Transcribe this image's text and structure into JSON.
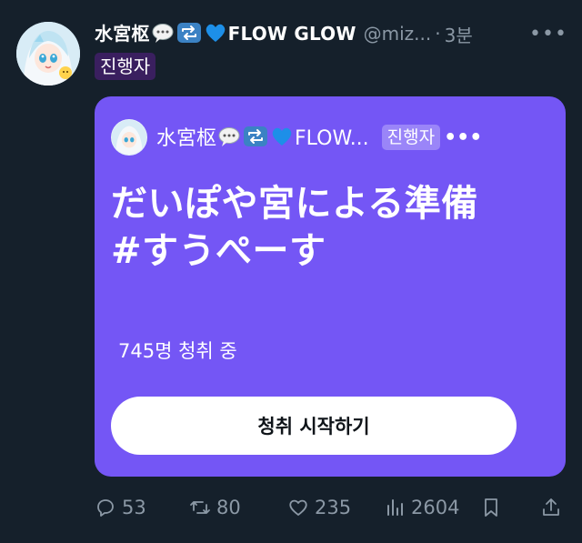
{
  "tweet": {
    "display_name": "水宮枢",
    "display_name_suffix": "FLOW GLOW",
    "name_emojis": [
      "speech-balloon-icon",
      "repeat-icon",
      "blue-heart-icon"
    ],
    "handle": "@miz...",
    "separator": "·",
    "time": "3분",
    "more_label": "•••",
    "host_badge": "진행자"
  },
  "space_card": {
    "background_color": "#7456f5",
    "host_name": "水宮枢",
    "host_name_suffix": "FLOW...",
    "host_badge": "진행자",
    "more_label": "•••",
    "title_line1": "だいぽや宮による準備",
    "title_line2": "#すうぺーす",
    "listener_count": "745명 청취 중",
    "start_button_label": "청취 시작하기"
  },
  "actions": {
    "replies": "53",
    "retweets": "80",
    "likes": "235",
    "views": "2604"
  },
  "colors": {
    "background": "#15202b",
    "muted_text": "#8b98a5",
    "badge_bg": "#3a1f5f"
  }
}
